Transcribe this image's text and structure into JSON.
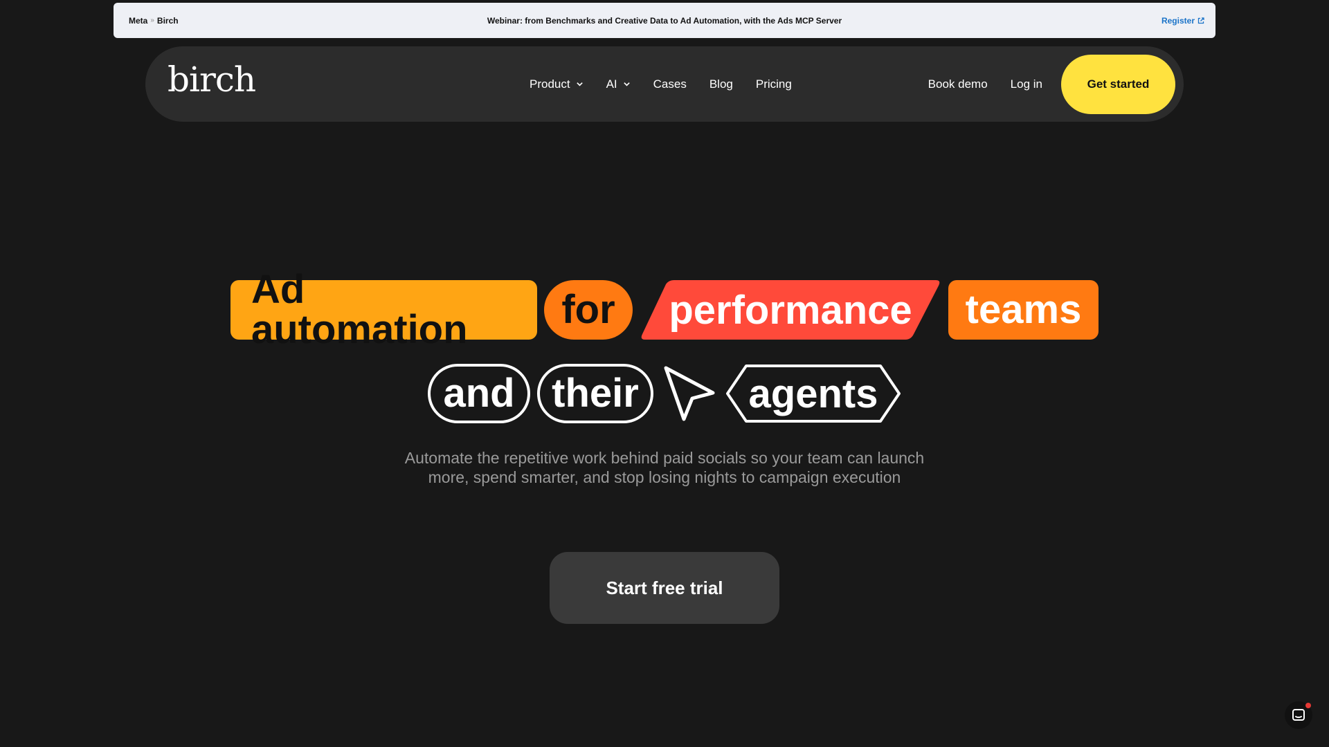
{
  "announcement": {
    "crumb_a": "Meta",
    "crumb_sep": "»",
    "crumb_b": "Birch",
    "message": "Webinar: from Benchmarks and Creative Data to Ad Automation, with the Ads MCP Server",
    "register_label": "Register"
  },
  "nav": {
    "logo": "birch",
    "links": [
      {
        "label": "Product",
        "has_dropdown": true
      },
      {
        "label": "AI",
        "has_dropdown": true
      },
      {
        "label": "Cases",
        "has_dropdown": false
      },
      {
        "label": "Blog",
        "has_dropdown": false
      },
      {
        "label": "Pricing",
        "has_dropdown": false
      }
    ],
    "book_demo": "Book demo",
    "log_in": "Log in",
    "get_started": "Get started"
  },
  "hero": {
    "word_ad_automation": "Ad automation",
    "word_for": "for",
    "word_performance": "performance",
    "word_teams": "teams",
    "word_and": "and",
    "word_their": "their",
    "word_agents": "agents",
    "subtitle_line1": "Automate the repetitive work behind paid socials so your team can launch",
    "subtitle_line2": "more, spend smarter, and stop losing nights to campaign execution",
    "cta": "Start free trial"
  },
  "colors": {
    "background": "#181818",
    "nav_bg": "#2c2c2c",
    "yellow": "#ffe23f",
    "amber": "#ffa514",
    "orange": "#ff7a12",
    "red": "#ff4a3a",
    "link_blue": "#1a73c8"
  },
  "icons": {
    "chevron": "chevron-down-icon",
    "external": "external-link-icon",
    "cursor": "cursor-arrow-icon",
    "chat": "chat-icon"
  }
}
